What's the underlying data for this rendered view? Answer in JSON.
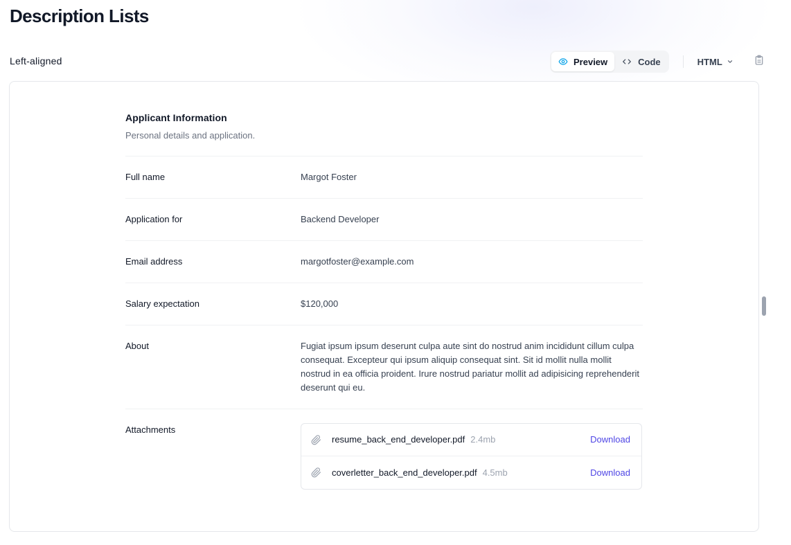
{
  "page": {
    "title": "Description Lists",
    "section_label": "Left-aligned"
  },
  "toolbar": {
    "preview_label": "Preview",
    "code_label": "Code",
    "language_label": "HTML",
    "active_tab": "Preview"
  },
  "icons": {
    "preview": "eye-icon",
    "code": "code-brackets-icon",
    "language_dropdown": "chevron-down-icon",
    "copy": "clipboard-icon",
    "attachment": "paperclip-icon"
  },
  "colors": {
    "accent": "#4f46e5",
    "text_primary": "#111827",
    "text_secondary": "#6b7280",
    "border": "#e5e7eb"
  },
  "applicant": {
    "heading": "Applicant Information",
    "subheading": "Personal details and application.",
    "fields": [
      {
        "label": "Full name",
        "value": "Margot Foster"
      },
      {
        "label": "Application for",
        "value": "Backend Developer"
      },
      {
        "label": "Email address",
        "value": "margotfoster@example.com"
      },
      {
        "label": "Salary expectation",
        "value": "$120,000"
      },
      {
        "label": "About",
        "value": "Fugiat ipsum ipsum deserunt culpa aute sint do nostrud anim incididunt cillum culpa consequat. Excepteur qui ipsum aliquip consequat sint. Sit id mollit nulla mollit nostrud in ea officia proident. Irure nostrud pariatur mollit ad adipisicing reprehenderit deserunt qui eu."
      }
    ],
    "attachments_label": "Attachments",
    "attachments": [
      {
        "name": "resume_back_end_developer.pdf",
        "size": "2.4mb",
        "action": "Download"
      },
      {
        "name": "coverletter_back_end_developer.pdf",
        "size": "4.5mb",
        "action": "Download"
      }
    ]
  }
}
